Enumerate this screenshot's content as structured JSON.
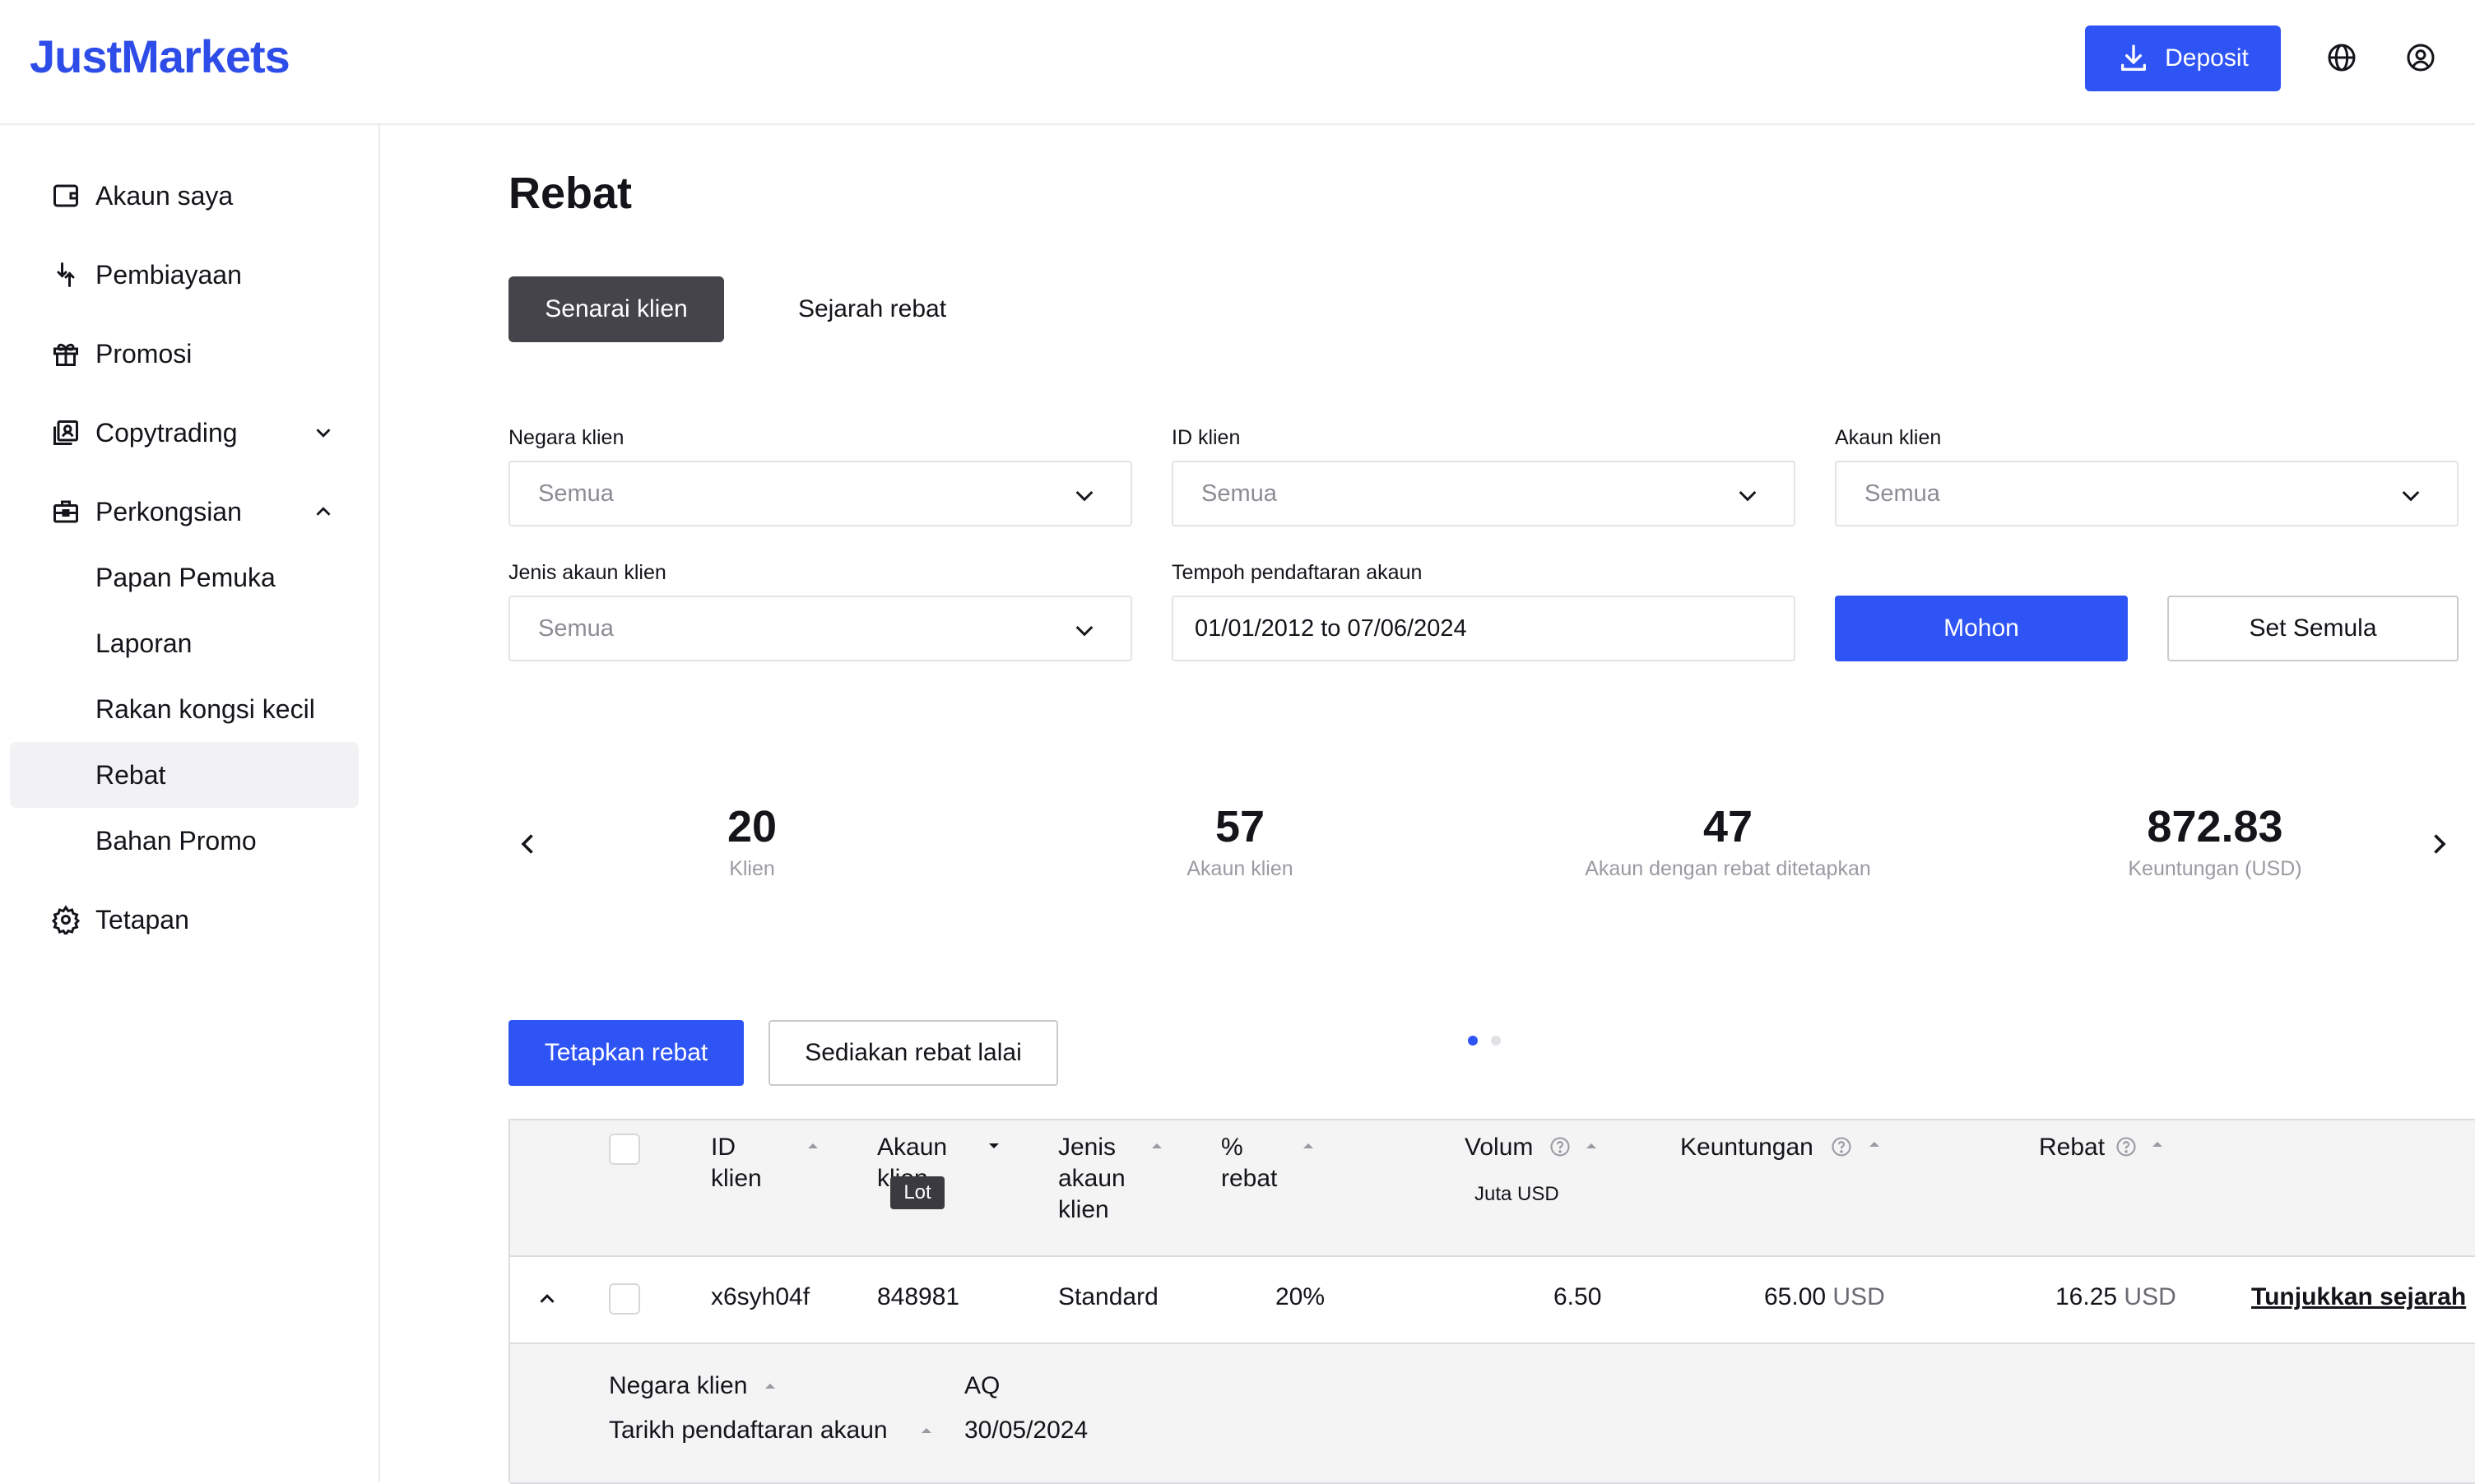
{
  "header": {
    "logo": "JustMarkets",
    "deposit_label": "Deposit"
  },
  "sidebar": {
    "items": [
      {
        "label": "Akaun saya",
        "icon": "wallet-icon"
      },
      {
        "label": "Pembiayaan",
        "icon": "transfer-icon"
      },
      {
        "label": "Promosi",
        "icon": "gift-icon"
      },
      {
        "label": "Copytrading",
        "icon": "copytrading-icon"
      },
      {
        "label": "Perkongsian",
        "icon": "briefcase-icon"
      },
      {
        "label": "Papan Pemuka"
      },
      {
        "label": "Laporan"
      },
      {
        "label": "Rakan kongsi kecil"
      },
      {
        "label": "Rebat"
      },
      {
        "label": "Bahan Promo"
      },
      {
        "label": "Tetapan",
        "icon": "gear-icon"
      }
    ]
  },
  "page": {
    "title": "Rebat",
    "tabs": [
      {
        "label": "Senarai klien",
        "active": true
      },
      {
        "label": "Sejarah rebat",
        "active": false
      }
    ]
  },
  "filters": {
    "country": {
      "label": "Negara klien",
      "value": "Semua"
    },
    "client_id": {
      "label": "ID klien",
      "value": "Semua"
    },
    "account": {
      "label": "Akaun klien",
      "value": "Semua"
    },
    "account_type": {
      "label": "Jenis akaun klien",
      "value": "Semua"
    },
    "period": {
      "label": "Tempoh pendaftaran akaun",
      "value": "01/01/2012 to 07/06/2024"
    },
    "apply_label": "Mohon",
    "reset_label": "Set Semula"
  },
  "stats": [
    {
      "value": "20",
      "caption": "Klien"
    },
    {
      "value": "57",
      "caption": "Akaun klien"
    },
    {
      "value": "47",
      "caption": "Akaun dengan rebat ditetapkan"
    },
    {
      "value": "872.83",
      "caption": "Keuntungan (USD)"
    }
  ],
  "actions": {
    "set_rebate": "Tetapkan rebat",
    "default_rebate": "Sediakan rebat lalai"
  },
  "table": {
    "headers": {
      "client_id": "ID klien",
      "account": "Akaun klien",
      "account_type": "Jenis akaun klien",
      "rebate_pct": "% rebat",
      "volume": "Volum",
      "profit": "Keuntungan",
      "rebate": "Rebat"
    },
    "volume_units": {
      "lot": "Lot",
      "usd": "Juta USD"
    },
    "row": {
      "client_id": "x6syh04f",
      "account": "848981",
      "account_type": "Standard",
      "rebate_pct": "20%",
      "volume": "6.50",
      "profit": "65.00",
      "profit_unit": "USD",
      "rebate": "16.25",
      "rebate_unit": "USD",
      "history_link": "Tunjukkan sejarah"
    },
    "details": {
      "country_label": "Negara klien",
      "country_value": "AQ",
      "reg_date_label": "Tarikh pendaftaran akaun",
      "reg_date_value": "30/05/2024"
    }
  },
  "colors": {
    "accent": "#2f54f5",
    "logo": "#2e4de8",
    "tab_active": "#44444a"
  }
}
